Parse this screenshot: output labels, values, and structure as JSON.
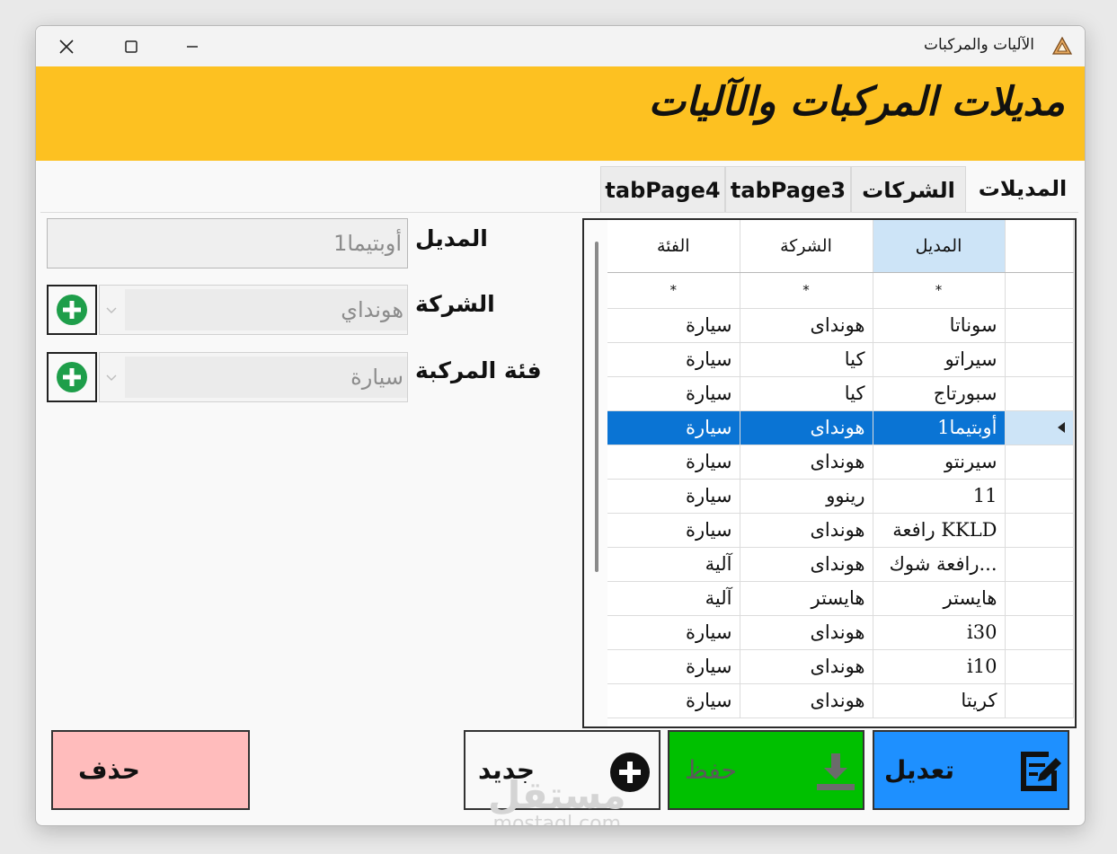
{
  "window": {
    "title": "الآليات والمركبات"
  },
  "banner": {
    "title": "مديلات المركبات والآليات"
  },
  "tabs": [
    {
      "label": "المديلات",
      "active": true
    },
    {
      "label": "الشركات",
      "active": false
    },
    {
      "label": "tabPage3",
      "active": false
    },
    {
      "label": "tabPage4",
      "active": false
    }
  ],
  "grid": {
    "columns": [
      "المديل",
      "الشركة",
      "الفئة"
    ],
    "new_row": [
      "*",
      "*",
      "*"
    ],
    "rows": [
      {
        "model": "سوناتا",
        "company": "هونداى",
        "category": "سيارة"
      },
      {
        "model": "سيراتو",
        "company": "كيا",
        "category": "سيارة"
      },
      {
        "model": "سبورتاج",
        "company": "كيا",
        "category": "سيارة"
      },
      {
        "model": "أوبتيما1",
        "company": "هونداى",
        "category": "سيارة",
        "selected": true
      },
      {
        "model": "سيرنتو",
        "company": "هونداى",
        "category": "سيارة"
      },
      {
        "model": "11",
        "company": "رينوو",
        "category": "سيارة"
      },
      {
        "model": "رافعة KKLD",
        "company": "هونداى",
        "category": "سيارة"
      },
      {
        "model": "رافعة شوك...",
        "company": "هونداى",
        "category": "آلية"
      },
      {
        "model": "هايستر",
        "company": "هايستر",
        "category": "آلية"
      },
      {
        "model": "i30",
        "company": "هونداى",
        "category": "سيارة"
      },
      {
        "model": "i10",
        "company": "هونداى",
        "category": "سيارة"
      },
      {
        "model": "كريتا",
        "company": "هونداى",
        "category": "سيارة"
      }
    ]
  },
  "form": {
    "model_label": "المديل",
    "model_value": "أوبتيما1",
    "company_label": "الشركة",
    "company_value": "هونداي",
    "category_label": "فئة المركبة",
    "category_value": "سيارة"
  },
  "buttons": {
    "edit": "تعديل",
    "save": "حفظ",
    "new": "جديد",
    "delete": "حذف"
  },
  "watermark": {
    "arabic": "مستقل",
    "latin": "mostaql.com"
  },
  "colors": {
    "banner": "#fdc121",
    "edit_button": "#1e90ff",
    "save_button": "#00c000",
    "delete_button": "#ffbcbc",
    "selection": "#0a74d4",
    "add_icon": "#1e9e4a"
  }
}
